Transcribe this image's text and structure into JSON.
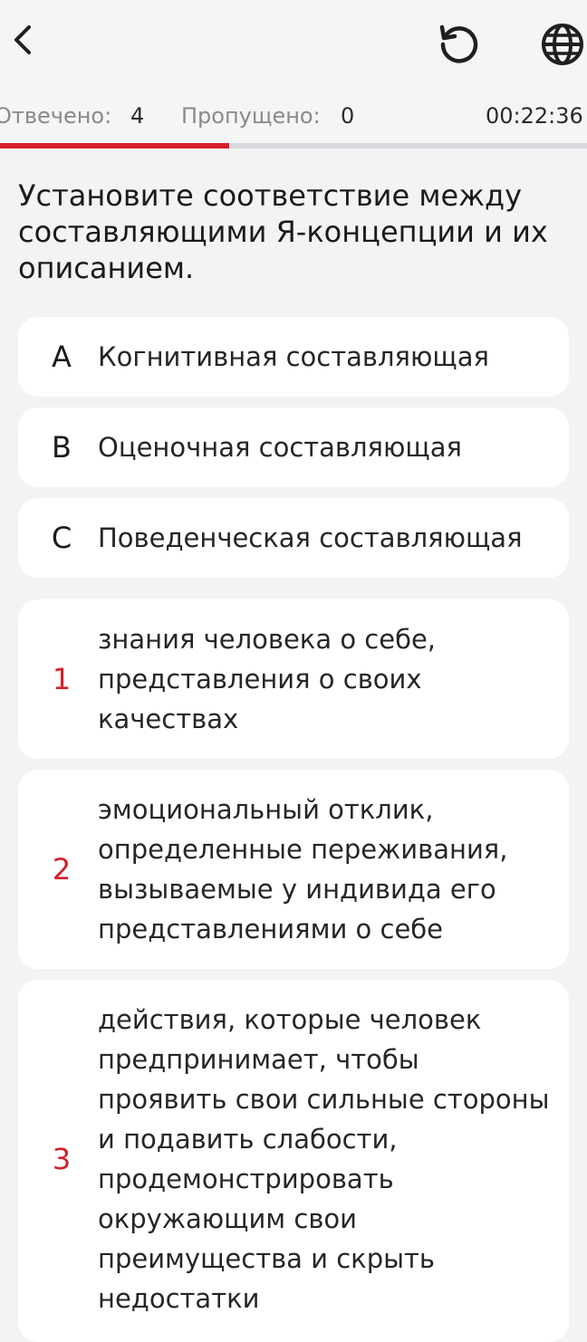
{
  "header": {
    "back_icon": "chevron-left-icon",
    "reset_icon": "refresh-icon",
    "language_icon": "globe-icon"
  },
  "status": {
    "answered_label": "Отвечено:",
    "answered_value": "4",
    "skipped_label": "Пропущено:",
    "skipped_value": "0",
    "timer": "00:22:36",
    "accent_color": "#d3202a",
    "progress_fraction": 0.39
  },
  "question": {
    "text": "Установите соответствие между составляющими Я-концепции и их описанием."
  },
  "options": [
    {
      "key": "A",
      "text": "Когнитивная составляющая"
    },
    {
      "key": "B",
      "text": "Оценочная составляющая"
    },
    {
      "key": "C",
      "text": "Поведенческая составляющая"
    }
  ],
  "descriptions": [
    {
      "key": "1",
      "text": "знания человека о себе, представления о своих качествах"
    },
    {
      "key": "2",
      "text": "эмоциональный отклик, определенные переживания, вызываемые у индивида его представлениями о себе"
    },
    {
      "key": "3",
      "text": "действия, которые человек предпринимает, чтобы проявить свои сильные стороны и подавить слабости, продемонстрировать окружающим свои преимущества и скрыть недостатки"
    }
  ]
}
